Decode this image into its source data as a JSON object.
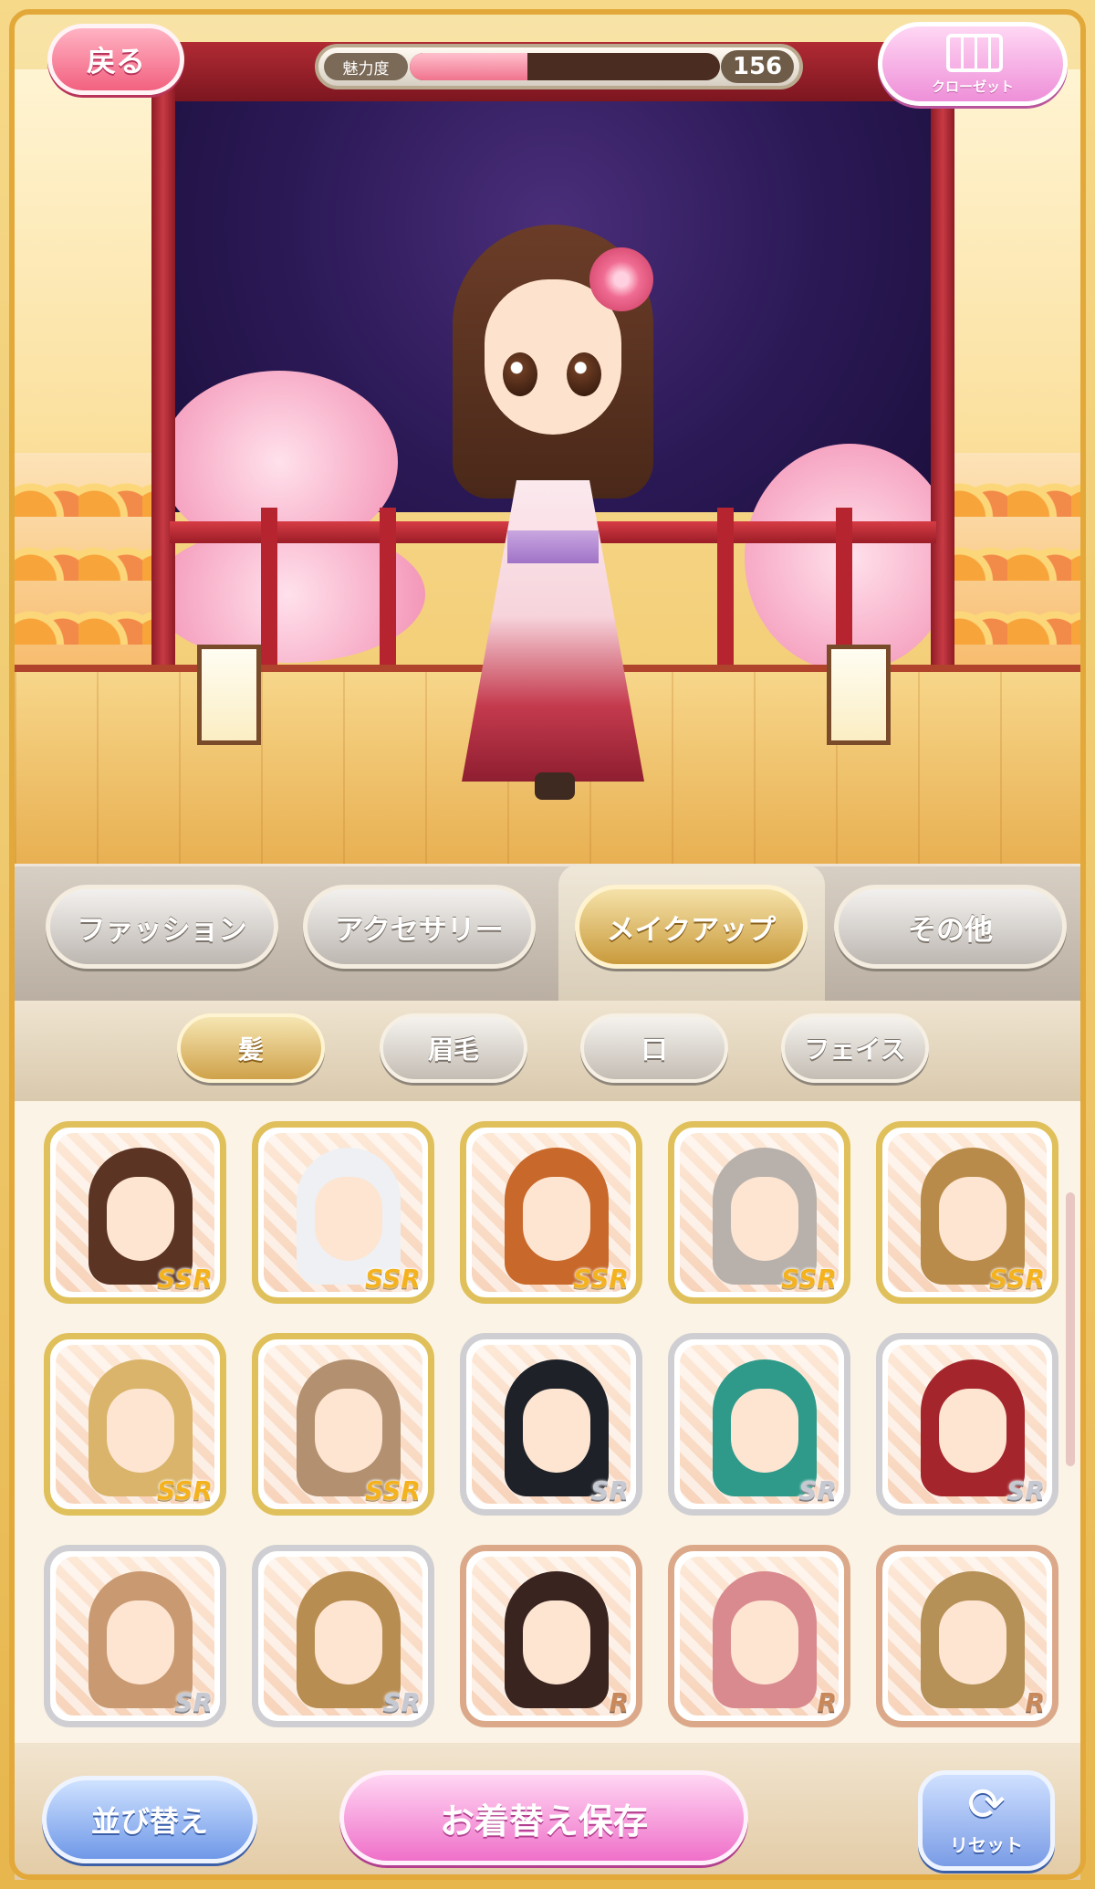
{
  "header": {
    "back_label": "戻る",
    "gauge_label": "魅力度",
    "gauge_level": 0.38,
    "gauge_value": "156",
    "closet_label": "クローゼット",
    "closet_icon": "closet-icon"
  },
  "tabs": [
    {
      "label": "ファッション",
      "active": false
    },
    {
      "label": "アクセサリー",
      "active": false
    },
    {
      "label": "メイクアップ",
      "active": true
    },
    {
      "label": "その他",
      "active": false
    }
  ],
  "subtabs": [
    {
      "label": "髪",
      "active": true
    },
    {
      "label": "眉毛",
      "active": false
    },
    {
      "label": "口",
      "active": false
    },
    {
      "label": "フェイス",
      "active": false
    }
  ],
  "items": [
    {
      "rarity": "SSR",
      "hair": "#5b3423"
    },
    {
      "rarity": "SSR",
      "hair": "#eef0f4"
    },
    {
      "rarity": "SSR",
      "hair": "#c8682a"
    },
    {
      "rarity": "SSR",
      "hair": "#b8b1ab"
    },
    {
      "rarity": "SSR",
      "hair": "#b88b4a"
    },
    {
      "rarity": "SSR",
      "hair": "#d9b46a"
    },
    {
      "rarity": "SSR",
      "hair": "#b29070"
    },
    {
      "rarity": "SR",
      "hair": "#1e2228"
    },
    {
      "rarity": "SR",
      "hair": "#2f9a8a"
    },
    {
      "rarity": "SR",
      "hair": "#a4262c"
    },
    {
      "rarity": "SR",
      "hair": "#c99a72"
    },
    {
      "rarity": "SR",
      "hair": "#b88d52"
    },
    {
      "rarity": "R",
      "hair": "#3a2420"
    },
    {
      "rarity": "R",
      "hair": "#d98a8e"
    },
    {
      "rarity": "R",
      "hair": "#b59157"
    }
  ],
  "bottom": {
    "sort_label": "並び替え",
    "save_label": "お着替え保存",
    "reset_label": "リセット",
    "reset_icon": "reset-icon"
  },
  "colors": {
    "ssr_frame": "#e0c05a",
    "sr_frame": "#cfcfd3",
    "r_frame": "#dba98a",
    "save_pink": "#ef70c9",
    "sort_blue": "#6f98e8"
  }
}
